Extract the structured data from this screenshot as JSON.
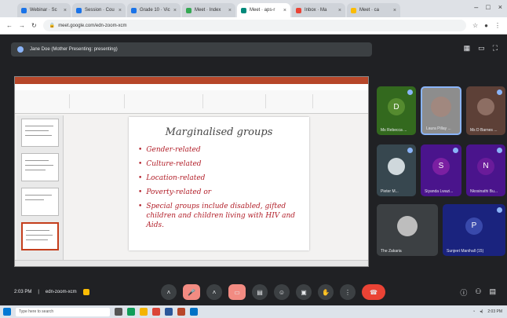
{
  "browser": {
    "tabs": [
      {
        "label": "Webinar · Sc"
      },
      {
        "label": "Session · Cou"
      },
      {
        "label": "Grade 10 · Vic"
      },
      {
        "label": "Meet · Index"
      },
      {
        "label": "Meet · aps-r",
        "active": true
      },
      {
        "label": "Inbox · Ma"
      },
      {
        "label": "Meet · ca"
      }
    ],
    "url": "meet.google.com/edn-zoom-xcm"
  },
  "meet": {
    "presenting_label": "Jane Doe (Mother Presenting: presenting)",
    "time": "2:03 PM",
    "meeting_code": "edn-zoom-xcm"
  },
  "slide": {
    "title": "Marginalised groups",
    "bullets": [
      "Gender-related",
      "Culture-related",
      "Location-related",
      "Poverty-related or",
      "Special groups include disabled, gifted children and children living with HIV and Aids."
    ]
  },
  "participants": [
    {
      "name": "Ms Rebecca ...",
      "initial": "D",
      "color": "#33691e"
    },
    {
      "name": "Laura Pillay ...",
      "initial": "",
      "color": "#6d6d6d"
    },
    {
      "name": "Ms D Barnes ...",
      "initial": "",
      "color": "#5d4037"
    },
    {
      "name": "Pieter M...",
      "initial": "",
      "color": "#37474f"
    },
    {
      "name": "Siyanda Lwazi...",
      "initial": "S",
      "color": "#7b1fa2"
    },
    {
      "name": "Nkosinathi Bu...",
      "initial": "N",
      "color": "#6a1b9a"
    },
    {
      "name": "The Zakaria",
      "initial": "",
      "color": "#424242"
    },
    {
      "name": "Sunjeet Manihall (15)",
      "initial": "P",
      "color": "#303f9f"
    }
  ],
  "taskbar": {
    "search_placeholder": "Type here to search",
    "clock": "2:03 PM"
  }
}
